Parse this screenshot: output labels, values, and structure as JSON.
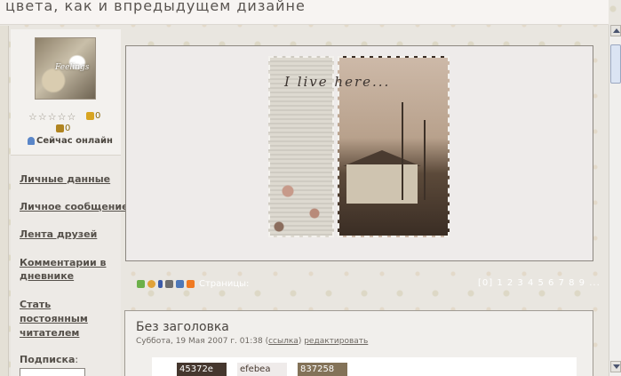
{
  "header": {
    "title": "цвета, как и впредыдущем дизайне"
  },
  "profile": {
    "avatar_text": "Feelings",
    "rating_stars": 5,
    "likes": "0",
    "dislikes": "0",
    "online_status": "Сейчас онлайн"
  },
  "sidebar": {
    "items": [
      {
        "label": "Личные данные"
      },
      {
        "label": "Личное сообщение"
      },
      {
        "label": "Лента друзей"
      },
      {
        "label": "Комментарии в"
      },
      {
        "label": "дневнике"
      },
      {
        "label": "Стать"
      },
      {
        "label": "постоянным"
      },
      {
        "label": "читателем"
      }
    ],
    "subscribe_label": "Подписка",
    "subscribe_colon": ":"
  },
  "image": {
    "caption": "I live here..."
  },
  "toolbar": {
    "pages_label": "Страницы:"
  },
  "pager": {
    "text": "[0] 1 2 3 4 5 6 7 8 9 ..."
  },
  "post": {
    "title": "Без заголовка",
    "date": "Суббота, 19 Мая 2007 г. 01:38",
    "link_open": "(",
    "link_label": "ссылка",
    "link_close": ")",
    "edit_label": "редактировать",
    "swatches": [
      "45372e",
      "efebea",
      "837258"
    ]
  },
  "colors": {
    "swatch_1": "#45372e",
    "swatch_2": "#efebea",
    "swatch_3": "#837258",
    "text_dark": "#55504a",
    "panel_border": "#8c8780"
  },
  "icons": [
    "star-icon",
    "thumb-up-icon",
    "thumb-down-icon",
    "user-online-icon",
    "scroll-up-icon",
    "scroll-down-icon"
  ]
}
